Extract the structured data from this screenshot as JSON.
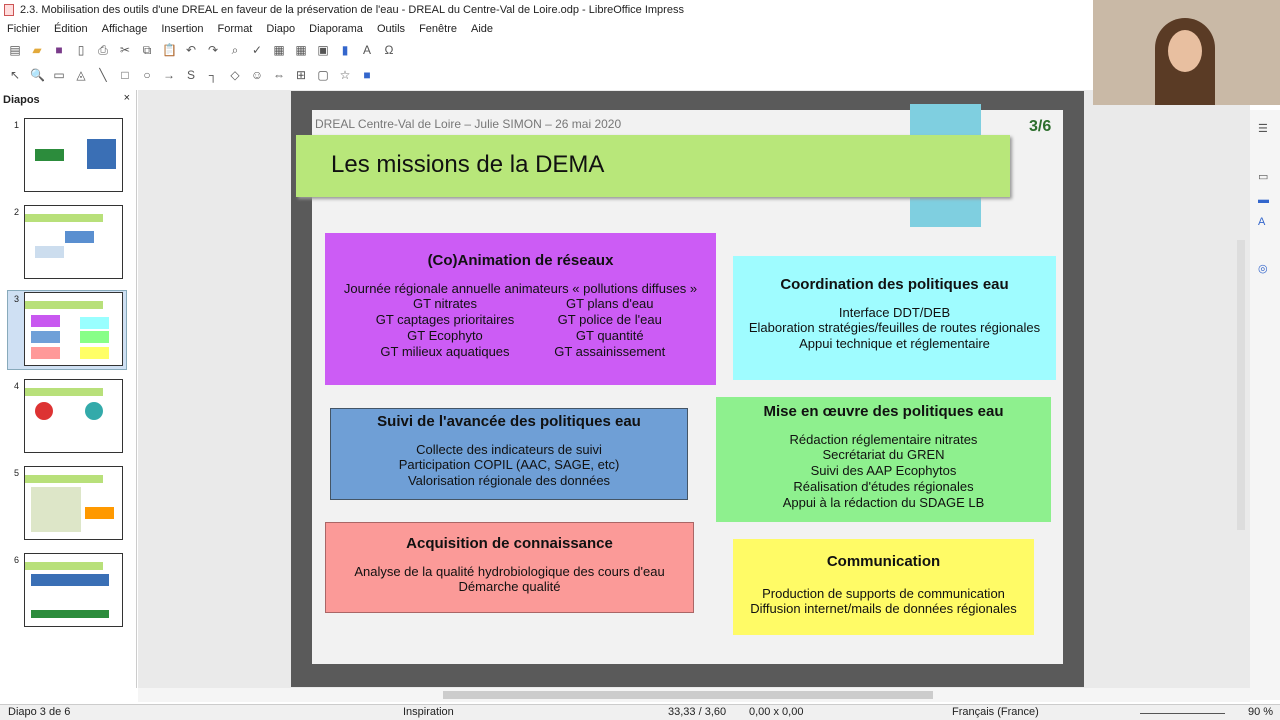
{
  "window": {
    "title": "2.3. Mobilisation des outils d'une DREAL en faveur de la préservation de l'eau - DREAL du Centre-Val de Loire.odp - LibreOffice Impress"
  },
  "menu": [
    "Fichier",
    "Édition",
    "Affichage",
    "Insertion",
    "Format",
    "Diapo",
    "Diaporama",
    "Outils",
    "Fenêtre",
    "Aide"
  ],
  "panel": {
    "title": "Diapos",
    "close": "×",
    "slides": [
      "1",
      "2",
      "3",
      "4",
      "5",
      "6"
    ],
    "selected": 3
  },
  "slide": {
    "header": "DREAL Centre-Val de Loire – Julie SIMON – 26 mai 2020",
    "page": "3/6",
    "title": "Les missions de la DEMA",
    "boxes": {
      "animation": {
        "title": "(Co)Animation de réseaux",
        "lines": [
          "Journée régionale annuelle animateurs « pollutions diffuses »"
        ],
        "left": [
          "GT nitrates",
          "GT captages prioritaires",
          "GT Ecophyto",
          "GT milieux aquatiques"
        ],
        "right": [
          "GT plans d'eau",
          "GT police de l'eau",
          "GT quantité",
          "GT assainissement"
        ]
      },
      "coordination": {
        "title": "Coordination des politiques eau",
        "lines": [
          "Interface DDT/DEB",
          "Elaboration stratégies/feuilles de routes régionales",
          "Appui technique et réglementaire"
        ]
      },
      "suivi": {
        "title": "Suivi de l'avancée des politiques eau",
        "lines": [
          "Collecte des indicateurs de suivi",
          "Participation COPIL (AAC, SAGE, etc)",
          "Valorisation régionale des données"
        ]
      },
      "miseenoeuvre": {
        "title": "Mise en œuvre des politiques eau",
        "lines": [
          "Rédaction réglementaire nitrates",
          "Secrétariat du GREN",
          "Suivi des AAP Ecophytos",
          "Réalisation d'études régionales",
          "Appui à la rédaction du SDAGE LB"
        ]
      },
      "acquisition": {
        "title": "Acquisition de connaissance",
        "lines": [
          "Analyse de la qualité hydrobiologique des cours d'eau",
          "Démarche qualité"
        ]
      },
      "communication": {
        "title": "Communication",
        "lines": [
          "Production de supports de communication",
          "Diffusion internet/mails de données régionales"
        ]
      }
    }
  },
  "status": {
    "slide": "Diapo 3 de 6",
    "master": "Inspiration",
    "position": "33,33 / 3,60",
    "size": "0,00 x 0,00",
    "language": "Français (France)",
    "zoom": "90 %"
  }
}
